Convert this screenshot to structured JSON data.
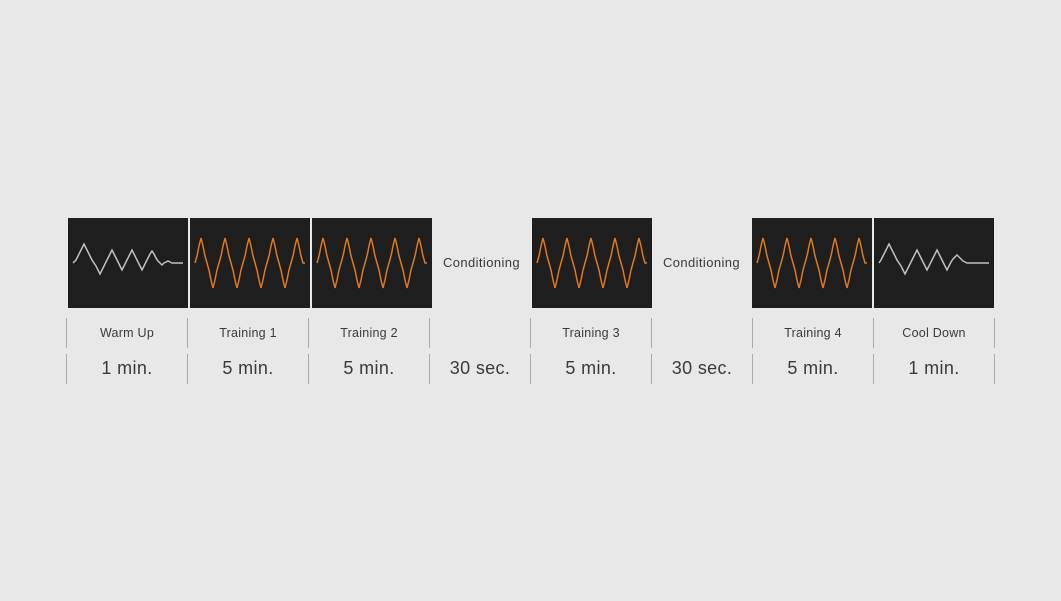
{
  "segments": [
    {
      "id": "warm-up",
      "label": "Warm Up",
      "time": "1 min.",
      "waveColor": "#c0c0c0",
      "waveType": "warmup"
    },
    {
      "id": "training-1",
      "label": "Training 1",
      "time": "5 min.",
      "waveColor": "#e07820",
      "waveType": "training"
    },
    {
      "id": "training-2",
      "label": "Training 2",
      "time": "5 min.",
      "waveColor": "#e07820",
      "waveType": "training"
    },
    {
      "id": "conditioning-1",
      "label": "Conditioning",
      "time": "30 sec.",
      "waveColor": null,
      "waveType": "text"
    },
    {
      "id": "training-3",
      "label": "Training 3",
      "time": "5 min.",
      "waveColor": "#e07820",
      "waveType": "training"
    },
    {
      "id": "conditioning-2",
      "label": "Conditioning",
      "time": "30 sec.",
      "waveColor": null,
      "waveType": "text"
    },
    {
      "id": "training-4",
      "label": "Training 4",
      "time": "5 min.",
      "waveColor": "#e07820",
      "waveType": "training"
    },
    {
      "id": "cool-down",
      "label": "Cool Down",
      "time": "1 min.",
      "waveColor": "#c0c0c0",
      "waveType": "cooldown"
    }
  ],
  "colors": {
    "background": "#e8e8e8",
    "waveformBg": "#1e1e1e",
    "orange": "#e07820",
    "gray": "#c0c0c0",
    "text": "#3a3a3a"
  }
}
